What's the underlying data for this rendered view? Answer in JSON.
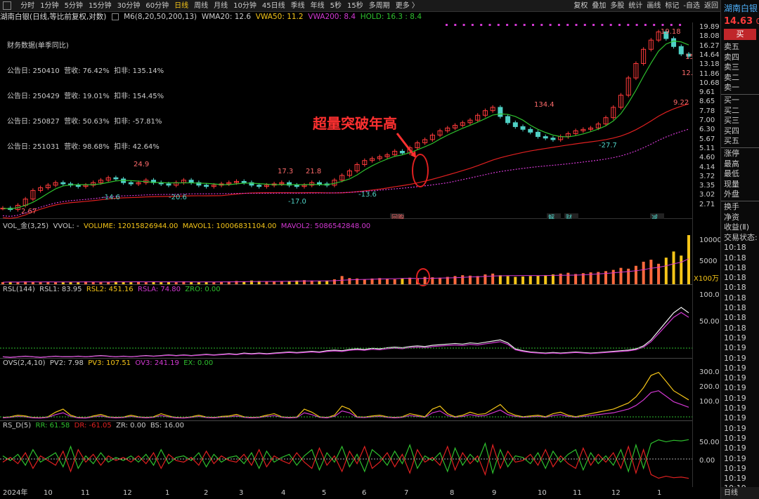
{
  "toolbar": {
    "intervals": [
      "分时",
      "1分钟",
      "5分钟",
      "15分钟",
      "30分钟",
      "60分钟",
      "日线",
      "周线",
      "月线",
      "10分钟",
      "45日线",
      "季线",
      "年线",
      "5秒",
      "15秒",
      "多周期",
      "更多 〉"
    ],
    "active": "日线",
    "right": [
      "复权",
      "叠加",
      "多股",
      "统计",
      "画线",
      "标记",
      "-自选",
      "返回"
    ]
  },
  "main": {
    "title": "湖南白银(日线,等比前复权,对数)",
    "ma": "M6(8,20,50,200,13)",
    "wma20": "WMA20: 12.6",
    "vwa50": "VWA50: 11.2",
    "vwa200": "VWA200: 8.4",
    "hold": "HOLD: 16.3 : 8.4",
    "fin_title": "财务数据(单季同比)",
    "fin_rows": [
      "公告日: 250410  营收: 76.42%  扣非: 135.14%",
      "公告日: 250429  营收: 19.01%  扣非: 154.45%",
      "公告日: 250827  营收: 50.63%  扣非: -57.81%",
      "公告日: 251031  营收: 98.68%  扣非: 42.64%"
    ],
    "annotation": "超量突破年高",
    "labels": [
      "24.9",
      "-14.6",
      "-20.6",
      "17.3",
      "21.8",
      "-17.0",
      "-13.6",
      "134.4",
      "-27.7",
      "19.18",
      "9.22",
      "2.67",
      "15",
      "12.4"
    ],
    "events": [
      "回购",
      "解",
      "财",
      "减"
    ],
    "yaxis": [
      "19.89",
      "18.08",
      "16.27",
      "14.64",
      "13.18",
      "11.86",
      "10.68",
      "9.61",
      "8.65",
      "7.78",
      "7.00",
      "6.30",
      "5.67",
      "5.11",
      "4.60",
      "4.14",
      "3.72",
      "3.35",
      "3.02",
      "2.71"
    ],
    "price": [
      2.71,
      2.67,
      2.8,
      3.0,
      3.3,
      3.4,
      3.5,
      3.6,
      3.55,
      3.5,
      3.45,
      3.5,
      3.6,
      3.7,
      3.8,
      3.75,
      3.6,
      3.55,
      3.6,
      3.7,
      3.6,
      3.55,
      3.5,
      3.6,
      3.7,
      3.6,
      3.5,
      3.45,
      3.5,
      3.55,
      3.6,
      3.65,
      3.6,
      3.5,
      3.45,
      3.5,
      3.55,
      3.6,
      3.5,
      3.45,
      3.5,
      3.6,
      3.55,
      3.5,
      3.7,
      3.9,
      4.1,
      4.4,
      4.6,
      4.7,
      4.8,
      4.9,
      5.1,
      5.0,
      5.3,
      5.6,
      5.8,
      6.1,
      6.4,
      6.6,
      6.8,
      7.0,
      7.2,
      7.6,
      8.0,
      8.3,
      7.5,
      7.0,
      6.7,
      6.5,
      6.3,
      6.0,
      5.9,
      5.8,
      6.0,
      6.2,
      6.4,
      6.5,
      6.6,
      6.9,
      7.4,
      8.3,
      9.5,
      11.5,
      13.5,
      15.8,
      17.5,
      19.18,
      17.8,
      16.3,
      15.0,
      14.63
    ]
  },
  "vol": {
    "title": "VOL_金(3,25)",
    "vvol": "VVOL: -",
    "volume": "VOLUME: 12015826944.00",
    "mavol1": "MAVOL1: 10006831104.00",
    "mavol2": "MAVOL2: 5086542848.00",
    "yaxis": [
      "10000",
      "5000",
      "X100万"
    ],
    "values": [
      5,
      6,
      5,
      7,
      6,
      5,
      6,
      5,
      5,
      6,
      5,
      7,
      6,
      5,
      6,
      7,
      6,
      5,
      6,
      5,
      6,
      5,
      6,
      5,
      7,
      6,
      5,
      6,
      5,
      6,
      7,
      8,
      7,
      9,
      8,
      7,
      6,
      7,
      8,
      9,
      10,
      9,
      8,
      9,
      12,
      20,
      15,
      14,
      12,
      14,
      15,
      13,
      12,
      14,
      16,
      15,
      18,
      17,
      16,
      18,
      20,
      22,
      21,
      20,
      24,
      26,
      22,
      20,
      18,
      19,
      20,
      21,
      22,
      24,
      26,
      28,
      25,
      27,
      29,
      30,
      32,
      35,
      40,
      38,
      45,
      55,
      60,
      50,
      65,
      80,
      70,
      120
    ]
  },
  "rsl": {
    "title": "RSL(144)",
    "rsl1": "RSL1: 83.95",
    "rsl2": "RSL2: 451.16",
    "rsla": "RSLA: 74.80",
    "zro": "ZRO: 0.00",
    "yaxis": [
      "100.0",
      "50.00"
    ],
    "values": [
      2,
      1,
      2,
      3,
      2,
      1,
      2,
      3,
      2,
      2,
      3,
      2,
      3,
      4,
      3,
      2,
      3,
      2,
      3,
      4,
      3,
      4,
      5,
      4,
      5,
      4,
      5,
      6,
      5,
      6,
      7,
      6,
      8,
      7,
      8,
      7,
      8,
      9,
      10,
      9,
      10,
      11,
      10,
      12,
      13,
      12,
      14,
      15,
      14,
      16,
      15,
      17,
      18,
      17,
      19,
      20,
      19,
      21,
      22,
      23,
      24,
      23,
      25,
      24,
      26,
      28,
      30,
      25,
      15,
      12,
      10,
      9,
      8,
      9,
      8,
      9,
      10,
      9,
      8,
      9,
      10,
      11,
      12,
      13,
      15,
      20,
      30,
      45,
      60,
      75,
      83.95,
      75
    ]
  },
  "ovs": {
    "title": "OVS(2,4,10)",
    "pv2": "PV2: 7.98",
    "pv3": "PV3: 107.51",
    "ov3": "OV3: 241.19",
    "ex": "EX: 0.00",
    "yaxis": [
      "300.0",
      "200.0",
      "100.0"
    ],
    "values": [
      5,
      10,
      20,
      15,
      5,
      3,
      10,
      40,
      60,
      20,
      5,
      3,
      15,
      25,
      10,
      5,
      8,
      20,
      10,
      5,
      10,
      30,
      15,
      5,
      3,
      10,
      20,
      8,
      5,
      12,
      15,
      25,
      10,
      5,
      8,
      20,
      30,
      10,
      5,
      8,
      60,
      40,
      10,
      5,
      20,
      80,
      60,
      10,
      8,
      15,
      20,
      10,
      5,
      10,
      30,
      20,
      10,
      60,
      80,
      30,
      10,
      20,
      40,
      25,
      30,
      60,
      90,
      40,
      20,
      10,
      15,
      20,
      10,
      30,
      40,
      20,
      10,
      20,
      30,
      40,
      50,
      60,
      80,
      100,
      140,
      200,
      280,
      300,
      241,
      180,
      150,
      120
    ]
  },
  "rsd": {
    "title": "RS_D(5)",
    "rr": "RR: 61.58",
    "dr": "DR: -61.05",
    "zr": "ZR: 0.00",
    "bs": "BS: 16.00",
    "yaxis": [
      "50.00",
      "0.00"
    ],
    "values": [
      10,
      -5,
      15,
      -20,
      30,
      -10,
      5,
      20,
      -25,
      40,
      -30,
      10,
      -15,
      20,
      -10,
      5,
      -5,
      10,
      -10,
      15,
      -20,
      30,
      -15,
      5,
      10,
      -5,
      20,
      -25,
      15,
      -10,
      5,
      10,
      -15,
      20,
      -30,
      25,
      -10,
      5,
      15,
      -20,
      10,
      30,
      -35,
      20,
      -10,
      40,
      -25,
      15,
      -40,
      30,
      10,
      -20,
      25,
      -15,
      45,
      -30,
      10,
      -5,
      20,
      -40,
      35,
      -20,
      15,
      -10,
      50,
      -45,
      30,
      -25,
      10,
      5,
      -15,
      20,
      -30,
      25,
      -10,
      15,
      30,
      -35,
      20,
      -15,
      10,
      -20,
      30,
      -40,
      45,
      -30,
      50,
      61.58,
      55,
      60,
      58,
      62
    ]
  },
  "xaxis": [
    "2024年",
    "10",
    "11",
    "12",
    "1",
    "2",
    "3",
    "4",
    "5",
    "6",
    "7",
    "8",
    "9",
    "10",
    "11",
    "12",
    "1"
  ],
  "right": {
    "name": "湖南白银",
    "price": "14.63",
    "chg": "0.",
    "buy": "买",
    "sell_labels": [
      "卖五",
      "卖四",
      "卖三",
      "卖二",
      "卖一"
    ],
    "buy_labels": [
      "买一",
      "买二",
      "买三",
      "买四",
      "买五"
    ],
    "stat_labels": [
      "涨停",
      "最高",
      "最低",
      "现量",
      "外盘",
      "换手",
      "净资",
      "收益(Ⅱ)",
      "交易状态:"
    ],
    "times": [
      "10:18",
      "10:18",
      "10:18",
      "10:18",
      "10:18",
      "10:18",
      "10:18",
      "10:18",
      "10:18",
      "10:19",
      "10:19",
      "10:19",
      "10:19",
      "10:19",
      "10:19",
      "10:19",
      "10:19",
      "10:19",
      "10:19",
      "10:19",
      "10:19",
      "10:19",
      "10:19",
      "10:19",
      "10:19"
    ],
    "bottom": "日线"
  },
  "colors": {
    "up": "#ff3b3b",
    "down": "#4fd1c5",
    "yellow": "#f5c518",
    "magenta": "#d238d2",
    "green": "#2ec02e",
    "red": "#e02020"
  }
}
